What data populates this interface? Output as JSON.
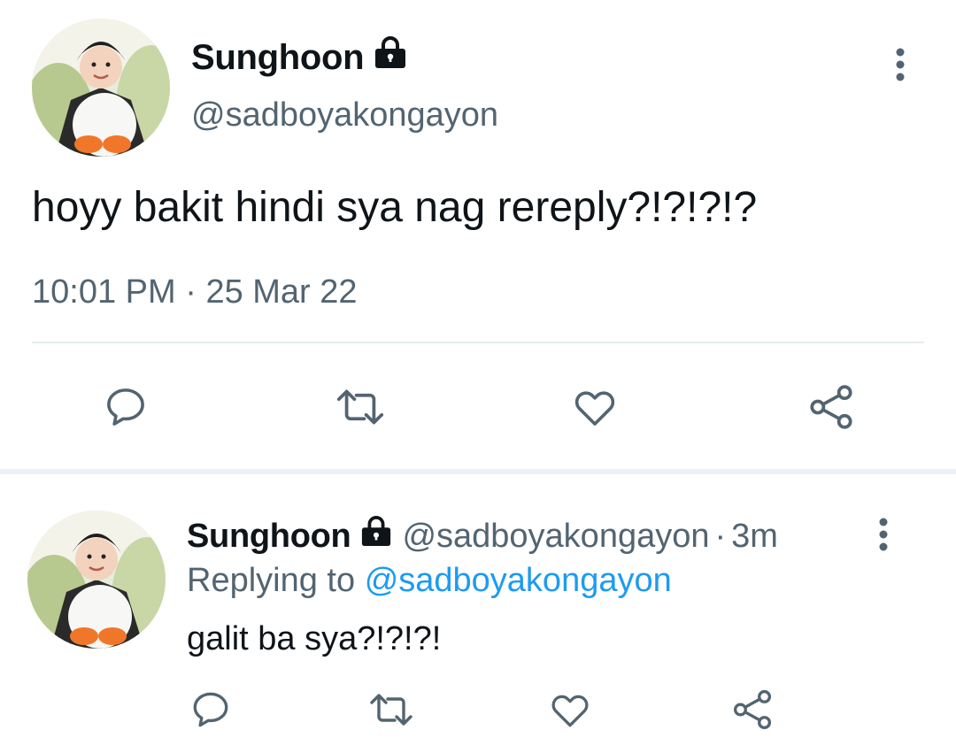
{
  "main_tweet": {
    "display_name": "Sunghoon",
    "handle": "@sadboyakongayon",
    "text": "hoyy bakit hindi sya nag rereply?!?!?!?",
    "time": "10:01 PM",
    "separator": "·",
    "date": "25 Mar 22",
    "locked": true
  },
  "reply_tweet": {
    "display_name": "Sunghoon",
    "handle": "@sadboyakongayon",
    "separator": "·",
    "time_ago": "3m",
    "replying_prefix": "Replying to",
    "replying_to": "@sadboyakongayon",
    "text": "galit ba sya?!?!?!",
    "locked": true
  },
  "icons": {
    "lock": "lock-icon",
    "more": "more-vertical-icon",
    "reply": "reply-icon",
    "retweet": "retweet-icon",
    "like": "heart-icon",
    "share": "share-icon"
  },
  "colors": {
    "text": "#0f1419",
    "secondary": "#536471",
    "link": "#1d9bf0",
    "divider": "#e6ecf0"
  }
}
